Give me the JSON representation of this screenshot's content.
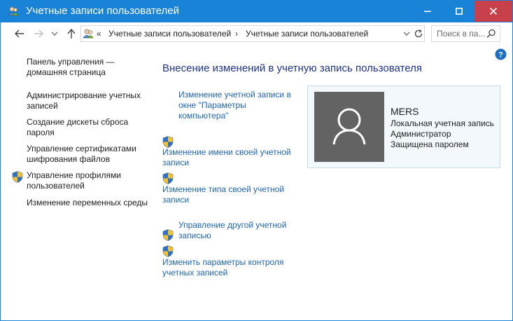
{
  "window": {
    "title": "Учетные записи пользователей"
  },
  "address": {
    "chevrons": "«",
    "crumbs": [
      "Учетные записи пользователей",
      "Учетные записи пользователей"
    ],
    "separator": "›"
  },
  "search": {
    "placeholder": "Поиск в па..."
  },
  "sidebar": {
    "home": "Панель управления — домашняя страница",
    "items": [
      "Администрирование учетных записей",
      "Создание дискеты сброса пароля",
      "Управление сертификатами шифрования файлов",
      "Управление профилями пользователей",
      "Изменение переменных среды"
    ]
  },
  "main": {
    "title": "Внесение изменений в учетную запись пользователя",
    "tasks": [
      "Изменение учетной записи в окне \"Параметры компьютера\"",
      "Изменение имени своей учетной записи",
      "Изменение типа своей учетной записи",
      "Управление другой учетной записью",
      "Изменить параметры контроля учетных записей"
    ]
  },
  "user": {
    "name": "MERS",
    "lines": [
      "Локальная учетная запись",
      "Администратор",
      "Защищена паролем"
    ]
  },
  "colors": {
    "titlebar": "#1883d7",
    "close": "#c7404a",
    "link": "#1e64b4",
    "heading": "#1e3287",
    "avatar_bg": "#636363"
  }
}
